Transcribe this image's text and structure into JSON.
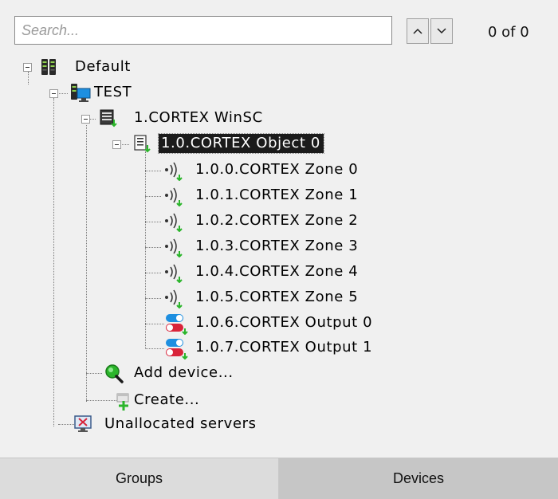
{
  "search": {
    "placeholder": "Search...",
    "value": ""
  },
  "navigation": {
    "prev_label": "^",
    "next_label": "v",
    "match_count": "0 of 0"
  },
  "tree": {
    "root": {
      "label": "Default",
      "icon": "server-rack-icon"
    },
    "server": {
      "label": "TEST",
      "icon": "monitor-server-icon"
    },
    "device": {
      "label": "1.CORTEX WinSC",
      "icon": "controller-device-icon"
    },
    "object": {
      "label": "1.0.CORTEX Object 0",
      "icon": "object-panel-icon",
      "selected": true
    },
    "zones": [
      {
        "label": "1.0.0.CORTEX Zone 0",
        "icon": "zone-sensor-icon"
      },
      {
        "label": "1.0.1.CORTEX Zone 1",
        "icon": "zone-sensor-icon"
      },
      {
        "label": "1.0.2.CORTEX Zone 2",
        "icon": "zone-sensor-icon"
      },
      {
        "label": "1.0.3.CORTEX Zone 3",
        "icon": "zone-sensor-icon"
      },
      {
        "label": "1.0.4.CORTEX Zone 4",
        "icon": "zone-sensor-icon"
      },
      {
        "label": "1.0.5.CORTEX Zone 5",
        "icon": "zone-sensor-icon"
      }
    ],
    "outputs": [
      {
        "label": "1.0.6.CORTEX Output 0",
        "icon": "output-toggle-icon"
      },
      {
        "label": "1.0.7.CORTEX Output 1",
        "icon": "output-toggle-icon"
      }
    ],
    "add_device": {
      "label": "Add device...",
      "icon": "magnifier-icon"
    },
    "create": {
      "label": "Create...",
      "icon": "create-plus-icon"
    },
    "unallocated": {
      "label": "Unallocated servers",
      "icon": "unallocated-monitor-icon"
    }
  },
  "tabs": [
    {
      "label": "Groups",
      "active": false
    },
    {
      "label": "Devices",
      "active": true
    }
  ],
  "colors": {
    "background": "#f0f0f0",
    "selection": "#1b1b1b",
    "tab_active": "#c6c6c6",
    "tab_inactive": "#dcdcdc",
    "accent_green": "#2bb52b",
    "accent_blue": "#1e8fe0",
    "accent_red": "#d9243a"
  }
}
